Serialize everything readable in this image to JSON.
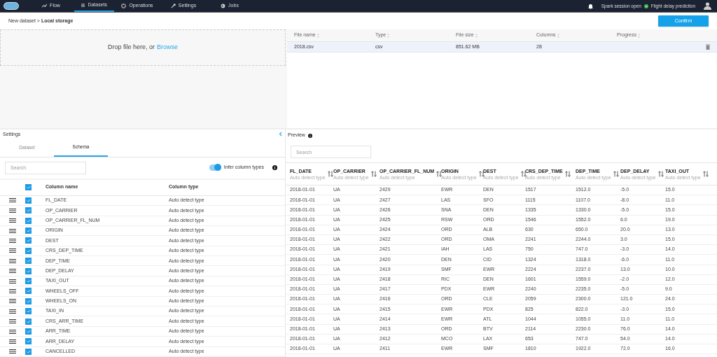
{
  "nav": {
    "items": [
      {
        "label": "Flow",
        "selected": false
      },
      {
        "label": "Datasets",
        "selected": true
      },
      {
        "label": "Operations",
        "selected": false
      },
      {
        "label": "Settings",
        "selected": false
      },
      {
        "label": "Jobs",
        "selected": false
      }
    ],
    "session": "Spark session open",
    "session_ok": true,
    "project": "Flight delay prediction"
  },
  "breadcrumb": "New dataset > **Local storage**",
  "confirm": "Confirm",
  "dropzone": {
    "text": "Drop file here, or",
    "link": "Browse"
  },
  "files": {
    "columns": [
      "File name",
      "Type",
      "File size",
      "Columns",
      "Progress"
    ],
    "rows": [
      {
        "cells": [
          "2018.csv",
          "csv",
          "851.62 MB",
          "28"
        ],
        "selected": true
      }
    ]
  },
  "settings": {
    "title": "Settings",
    "tabs": [
      {
        "label": "Dataset",
        "selected": false
      },
      {
        "label": "Schema",
        "selected": true
      }
    ],
    "search_placeholder": "Search",
    "toggle": {
      "label": "Infer column types",
      "on": true
    },
    "all_checked": true,
    "columns": [
      "Column name",
      "Column type"
    ],
    "rows": [
      {
        "name": "FL_DATE",
        "type": "Auto detect type",
        "checked": true
      },
      {
        "name": "OP_CARRIER",
        "type": "Auto detect type",
        "checked": true
      },
      {
        "name": "OP_CARRIER_FL_NUM",
        "type": "Auto detect type",
        "checked": true
      },
      {
        "name": "ORIGIN",
        "type": "Auto detect type",
        "checked": true
      },
      {
        "name": "DEST",
        "type": "Auto detect type",
        "checked": true
      },
      {
        "name": "CRS_DEP_TIME",
        "type": "Auto detect type",
        "checked": true
      },
      {
        "name": "DEP_TIME",
        "type": "Auto detect type",
        "checked": true
      },
      {
        "name": "DEP_DELAY",
        "type": "Auto detect type",
        "checked": true
      },
      {
        "name": "TAXI_OUT",
        "type": "Auto detect type",
        "checked": true
      },
      {
        "name": "WHEELS_OFF",
        "type": "Auto detect type",
        "checked": true
      },
      {
        "name": "WHEELS_ON",
        "type": "Auto detect type",
        "checked": true
      },
      {
        "name": "TAXI_IN",
        "type": "Auto detect type",
        "checked": true
      },
      {
        "name": "CRS_ARR_TIME",
        "type": "Auto detect type",
        "checked": true
      },
      {
        "name": "ARR_TIME",
        "type": "Auto detect type",
        "checked": true
      },
      {
        "name": "ARR_DELAY",
        "type": "Auto detect type",
        "checked": true
      },
      {
        "name": "CANCELLED",
        "type": "Auto detect type",
        "checked": true
      }
    ]
  },
  "preview": {
    "title": "Preview",
    "search_placeholder": "Search",
    "columns": [
      {
        "name": "FL_DATE",
        "type": "Auto detect type"
      },
      {
        "name": "OP_CARRIER",
        "type": "Auto detect type"
      },
      {
        "name": "OP_CARRIER_FL_NUM",
        "type": "Auto detect type"
      },
      {
        "name": "ORIGIN",
        "type": "Auto detect type"
      },
      {
        "name": "DEST",
        "type": "Auto detect type"
      },
      {
        "name": "CRS_DEP_TIME",
        "type": "Auto detect type"
      },
      {
        "name": "DEP_TIME",
        "type": "Auto detect type"
      },
      {
        "name": "DEP_DELAY",
        "type": "Auto detect type"
      },
      {
        "name": "TAXI_OUT",
        "type": "Auto detect type"
      }
    ],
    "rows": [
      [
        "2018-01-01",
        "UA",
        "2429",
        "EWR",
        "DEN",
        "1517",
        "1512.0",
        "-5.0",
        "15.0"
      ],
      [
        "2018-01-01",
        "UA",
        "2427",
        "LAS",
        "SFO",
        "1115",
        "1107.0",
        "-8.0",
        "11.0"
      ],
      [
        "2018-01-01",
        "UA",
        "2426",
        "SNA",
        "DEN",
        "1335",
        "1330.0",
        "-5.0",
        "15.0"
      ],
      [
        "2018-01-01",
        "UA",
        "2425",
        "RSW",
        "ORD",
        "1546",
        "1552.0",
        "6.0",
        "19.0"
      ],
      [
        "2018-01-01",
        "UA",
        "2424",
        "ORD",
        "ALB",
        "630",
        "650.0",
        "20.0",
        "13.0"
      ],
      [
        "2018-01-01",
        "UA",
        "2422",
        "ORD",
        "OMA",
        "2241",
        "2244.0",
        "3.0",
        "15.0"
      ],
      [
        "2018-01-01",
        "UA",
        "2421",
        "IAH",
        "LAS",
        "750",
        "747.0",
        "-3.0",
        "14.0"
      ],
      [
        "2018-01-01",
        "UA",
        "2420",
        "DEN",
        "CID",
        "1324",
        "1318.0",
        "-6.0",
        "11.0"
      ],
      [
        "2018-01-01",
        "UA",
        "2419",
        "SMF",
        "EWR",
        "2224",
        "2237.0",
        "13.0",
        "10.0"
      ],
      [
        "2018-01-01",
        "UA",
        "2418",
        "RIC",
        "DEN",
        "1601",
        "1559.0",
        "-2.0",
        "12.0"
      ],
      [
        "2018-01-01",
        "UA",
        "2417",
        "PDX",
        "EWR",
        "2240",
        "2235.0",
        "-5.0",
        "9.0"
      ],
      [
        "2018-01-01",
        "UA",
        "2416",
        "ORD",
        "CLE",
        "2059",
        "2300.0",
        "121.0",
        "24.0"
      ],
      [
        "2018-01-01",
        "UA",
        "2415",
        "EWR",
        "PDX",
        "825",
        "822.0",
        "-3.0",
        "15.0"
      ],
      [
        "2018-01-01",
        "UA",
        "2414",
        "EWR",
        "ATL",
        "1044",
        "1055.0",
        "11.0",
        "11.0"
      ],
      [
        "2018-01-01",
        "UA",
        "2413",
        "ORD",
        "BTV",
        "2114",
        "2230.0",
        "76.0",
        "14.0"
      ],
      [
        "2018-01-01",
        "UA",
        "2412",
        "MCO",
        "LAX",
        "653",
        "747.0",
        "54.0",
        "14.0"
      ],
      [
        "2018-01-01",
        "UA",
        "2411",
        "EWR",
        "SMF",
        "1810",
        "1922.0",
        "72.0",
        "16.0"
      ]
    ]
  }
}
